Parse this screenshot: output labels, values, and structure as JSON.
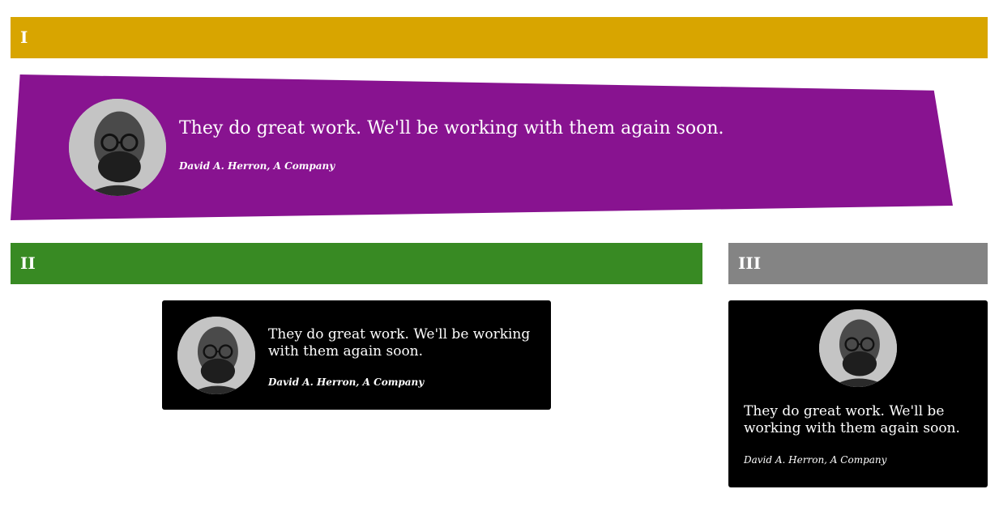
{
  "sections": [
    {
      "label": "I",
      "testimonial": {
        "quote": "They do great work. We'll be working with them again soon.",
        "author": "David A. Herron, A Company"
      }
    },
    {
      "label": "II",
      "testimonial": {
        "quote": "They do great work. We'll be working with them again soon.",
        "author": "David A. Herron, A Company"
      }
    },
    {
      "label": "III",
      "testimonial": {
        "quote": "They do great work. We'll be working with them again soon.",
        "author": "David A. Herron, A Company"
      }
    }
  ],
  "colors": {
    "section_1_header": "#D8A500",
    "section_1_banner": "#881390",
    "section_2_header": "#388A23",
    "section_3_header": "#848484",
    "card_background": "#000000"
  }
}
